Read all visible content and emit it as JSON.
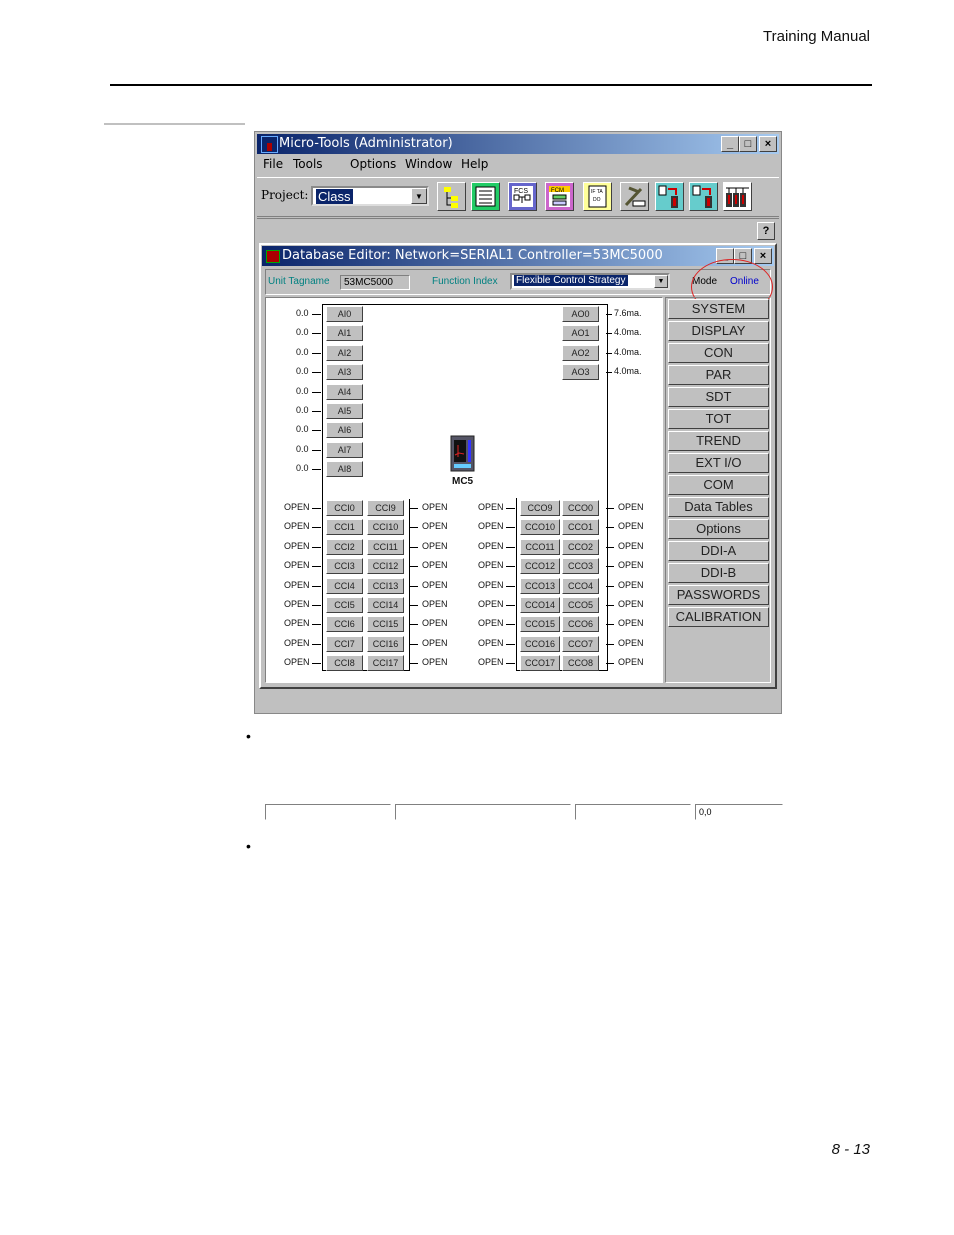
{
  "page": {
    "header": "Training Manual",
    "page_number": "8 - 13",
    "bullets": [
      "",
      ""
    ]
  },
  "app": {
    "title": "Micro-Tools (Administrator)",
    "caption_buttons": {
      "minimize": "_",
      "maximize": "□",
      "close": "×"
    },
    "menu": [
      "File",
      "Tools",
      "Options",
      "Window",
      "Help"
    ],
    "project_label": "Project:",
    "project_value": "Class",
    "toolbar_icons": [
      "project-tree-icon",
      "database-editor-icon",
      "fcs-icon",
      "fcm-icon",
      "ifta-icon",
      "tools-hammer-icon",
      "download-icon",
      "upload-icon",
      "controllers-icon"
    ],
    "help_label": "?"
  },
  "editor": {
    "title": "Database Editor: Network=SERIAL1  Controller=53MC5000",
    "unit_tagname_label": "Unit Tagname",
    "unit_tagname_value": "53MC5000",
    "function_index_label": "Function Index",
    "function_index_value": "Flexible Control Strategy",
    "mode_label": "Mode",
    "mode_value": "Online",
    "controller_label": "MC5",
    "analog_inputs": [
      {
        "name": "AI0",
        "value": "0.0"
      },
      {
        "name": "AI1",
        "value": "0.0"
      },
      {
        "name": "AI2",
        "value": "0.0"
      },
      {
        "name": "AI3",
        "value": "0.0"
      },
      {
        "name": "AI4",
        "value": "0.0"
      },
      {
        "name": "AI5",
        "value": "0.0"
      },
      {
        "name": "AI6",
        "value": "0.0"
      },
      {
        "name": "AI7",
        "value": "0.0"
      },
      {
        "name": "AI8",
        "value": "0.0"
      }
    ],
    "analog_outputs": [
      {
        "name": "AO0",
        "value": "7.6ma."
      },
      {
        "name": "AO1",
        "value": "4.0ma."
      },
      {
        "name": "AO2",
        "value": "4.0ma."
      },
      {
        "name": "AO3",
        "value": "4.0ma."
      }
    ],
    "cci_left": [
      {
        "name": "CCI0",
        "value": "OPEN"
      },
      {
        "name": "CCI1",
        "value": "OPEN"
      },
      {
        "name": "CCI2",
        "value": "OPEN"
      },
      {
        "name": "CCI3",
        "value": "OPEN"
      },
      {
        "name": "CCI4",
        "value": "OPEN"
      },
      {
        "name": "CCI5",
        "value": "OPEN"
      },
      {
        "name": "CCI6",
        "value": "OPEN"
      },
      {
        "name": "CCI7",
        "value": "OPEN"
      },
      {
        "name": "CCI8",
        "value": "OPEN"
      }
    ],
    "cci_right": [
      {
        "name": "CCI9",
        "value": "OPEN"
      },
      {
        "name": "CCI10",
        "value": "OPEN"
      },
      {
        "name": "CCI11",
        "value": "OPEN"
      },
      {
        "name": "CCI12",
        "value": "OPEN"
      },
      {
        "name": "CCI13",
        "value": "OPEN"
      },
      {
        "name": "CCI14",
        "value": "OPEN"
      },
      {
        "name": "CCI15",
        "value": "OPEN"
      },
      {
        "name": "CCI16",
        "value": "OPEN"
      },
      {
        "name": "CCI17",
        "value": "OPEN"
      }
    ],
    "cco_left": [
      {
        "name": "CCO9",
        "value": "OPEN"
      },
      {
        "name": "CCO10",
        "value": "OPEN"
      },
      {
        "name": "CCO11",
        "value": "OPEN"
      },
      {
        "name": "CCO12",
        "value": "OPEN"
      },
      {
        "name": "CCO13",
        "value": "OPEN"
      },
      {
        "name": "CCO14",
        "value": "OPEN"
      },
      {
        "name": "CCO15",
        "value": "OPEN"
      },
      {
        "name": "CCO16",
        "value": "OPEN"
      },
      {
        "name": "CCO17",
        "value": "OPEN"
      }
    ],
    "cco_right": [
      {
        "name": "CCO0",
        "value": "OPEN"
      },
      {
        "name": "CCO1",
        "value": "OPEN"
      },
      {
        "name": "CCO2",
        "value": "OPEN"
      },
      {
        "name": "CCO3",
        "value": "OPEN"
      },
      {
        "name": "CCO4",
        "value": "OPEN"
      },
      {
        "name": "CCO5",
        "value": "OPEN"
      },
      {
        "name": "CCO6",
        "value": "OPEN"
      },
      {
        "name": "CCO7",
        "value": "OPEN"
      },
      {
        "name": "CCO8",
        "value": "OPEN"
      }
    ],
    "side_buttons": [
      "SYSTEM",
      "DISPLAY",
      "CON",
      "PAR",
      "SDT",
      "TOT",
      "TREND",
      "EXT I/O",
      "COM",
      "Data Tables",
      "Options",
      "DDI-A",
      "DDI-B",
      "PASSWORDS",
      "CALIBRATION"
    ]
  },
  "statusbar": {
    "panels": [
      "",
      "",
      "",
      "0,0"
    ]
  },
  "colors": {
    "title_gradient_start": "#0a246a",
    "title_gradient_end": "#a6caf0",
    "annotation_circle": "#dd2222",
    "label_teal": "#008080",
    "online_blue": "#0000cc"
  }
}
